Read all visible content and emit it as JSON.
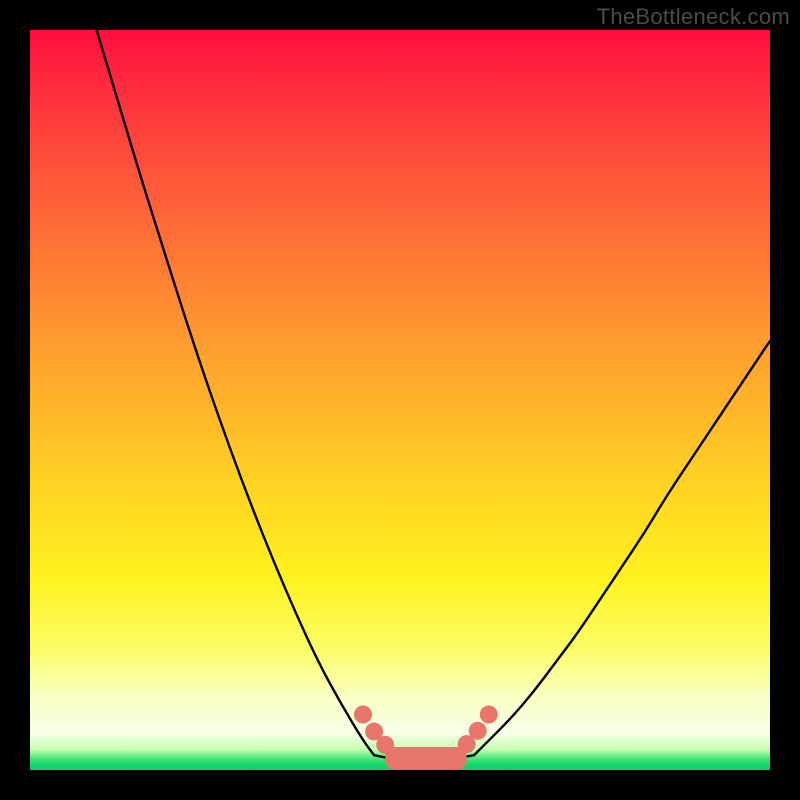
{
  "attribution": "TheBottleneck.com",
  "chart_data": {
    "type": "line",
    "title": "",
    "xlabel": "",
    "ylabel": "",
    "xlim": [
      0,
      100
    ],
    "ylim": [
      0,
      100
    ],
    "series": [
      {
        "name": "left-branch",
        "x": [
          9,
          12,
          15,
          18,
          21,
          24,
          27,
          30,
          33,
          36,
          39,
          42,
          45,
          46.5
        ],
        "values": [
          100,
          90,
          80,
          70.5,
          61,
          52,
          43.5,
          35.5,
          28,
          21,
          14.5,
          9,
          4,
          2
        ]
      },
      {
        "name": "right-branch",
        "x": [
          60,
          62,
          65,
          68,
          71,
          74,
          77,
          80,
          83,
          86,
          89,
          92,
          95,
          98,
          100
        ],
        "values": [
          2,
          4,
          7,
          10.5,
          14.5,
          18.5,
          23,
          27.5,
          32,
          37,
          41.5,
          46,
          50.5,
          55,
          58
        ]
      },
      {
        "name": "valley-floor",
        "x": [
          46.5,
          50,
          53,
          56,
          60
        ],
        "values": [
          2,
          1.3,
          1.1,
          1.3,
          2
        ]
      }
    ],
    "markers": [
      {
        "name": "left-upper-dot",
        "x": 45,
        "y": 7.5
      },
      {
        "name": "left-mid-dot",
        "x": 46.5,
        "y": 5.2
      },
      {
        "name": "left-lower-dot",
        "x": 48,
        "y": 3.4
      },
      {
        "name": "right-lower-dot",
        "x": 59,
        "y": 3.5
      },
      {
        "name": "right-mid-dot",
        "x": 60.5,
        "y": 5.3
      },
      {
        "name": "right-upper-dot",
        "x": 62,
        "y": 7.5
      }
    ],
    "floor_bar": {
      "x_start": 48,
      "x_end": 59,
      "y": 1.6,
      "thickness": 3.0
    },
    "colors": {
      "curve": "#000000",
      "marker_fill": "#e9766d",
      "gradient_top": "#ff0d3f",
      "gradient_mid": "#ffd21e",
      "gradient_bottom": "#0ecf6a",
      "frame": "#000000"
    }
  }
}
